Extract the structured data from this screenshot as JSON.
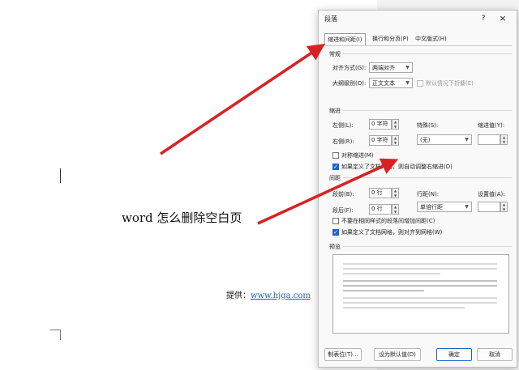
{
  "document": {
    "title": "word 怎么删除空白页",
    "provider_label": "提供：",
    "provider_link": "www.hjga.com"
  },
  "dialog": {
    "title": "段落",
    "help": "?",
    "close": "×",
    "tabs": [
      {
        "label": "缩进和间距(I)",
        "active": true
      },
      {
        "label": "换行和分页(P)",
        "active": false
      },
      {
        "label": "中文版式(H)",
        "active": false
      }
    ],
    "general": {
      "section": "常规",
      "alignment_label": "对齐方式(G):",
      "alignment_value": "两端对齐",
      "outline_label": "大纲级别(O):",
      "outline_value": "正文文本",
      "collapse_label": "默认情况下折叠(E)"
    },
    "indent": {
      "section": "缩进",
      "left_label": "左侧(L):",
      "left_value": "0 字符",
      "right_label": "右侧(R):",
      "right_value": "0 字符",
      "special_label": "特殊(S):",
      "special_value": "(无)",
      "indent_value_label": "缩进值(Y):",
      "mirror_label": "对称缩进(M)",
      "auto_adjust_label": "如果定义了文档网格，则自动调整右缩进(D)"
    },
    "spacing": {
      "section": "间距",
      "before_label": "段前(B):",
      "before_value": "0 行",
      "after_label": "段后(F):",
      "after_value": "0 行",
      "line_label": "行距(N):",
      "line_value": "单倍行距",
      "set_value_label": "设置值(A):",
      "no_space_label": "不要在相同样式的段落间增加间距(C)",
      "snap_grid_label": "如果定义了文档网格，则对齐到网格(W)"
    },
    "preview": {
      "section": "预览"
    },
    "buttons": {
      "tabs": "制表位(T)...",
      "default": "设为默认值(D)",
      "ok": "确定",
      "cancel": "取消"
    }
  },
  "colors": {
    "arrow": "#d92121",
    "accent": "#1b64c8"
  },
  "icons": {
    "dropdown": "chevron-down-icon",
    "spinner": "spinner-icon",
    "checkbox": "checkbox-icon",
    "arrow": "arrow-icon"
  }
}
